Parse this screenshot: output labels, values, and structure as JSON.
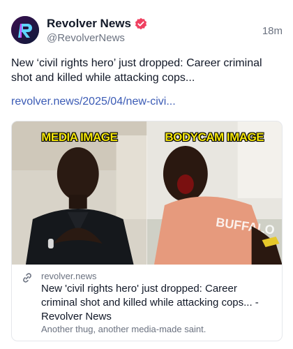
{
  "author": {
    "name": "Revolver News",
    "handle": "@RevolverNews",
    "verified": true,
    "avatar_icon": "revolver-logo-icon",
    "verified_color": "#ef4060"
  },
  "post": {
    "time": "18m",
    "text": "New ‘civil rights hero’ just dropped: Career criminal shot and killed while attacking cops...",
    "link": "revolver.news/2025/04/new-civi..."
  },
  "card": {
    "image_captions": [
      "MEDIA IMAGE",
      "BODYCAM IMAGE"
    ],
    "link_icon": "link-icon",
    "domain": "revolver.news",
    "title": "New 'civil rights hero' just dropped: Career criminal shot and killed while attacking cops... - Revolver News",
    "description": "Another thug, another media-made saint."
  },
  "colors": {
    "link": "#3b5bb5",
    "caption": "#f4e60b"
  }
}
